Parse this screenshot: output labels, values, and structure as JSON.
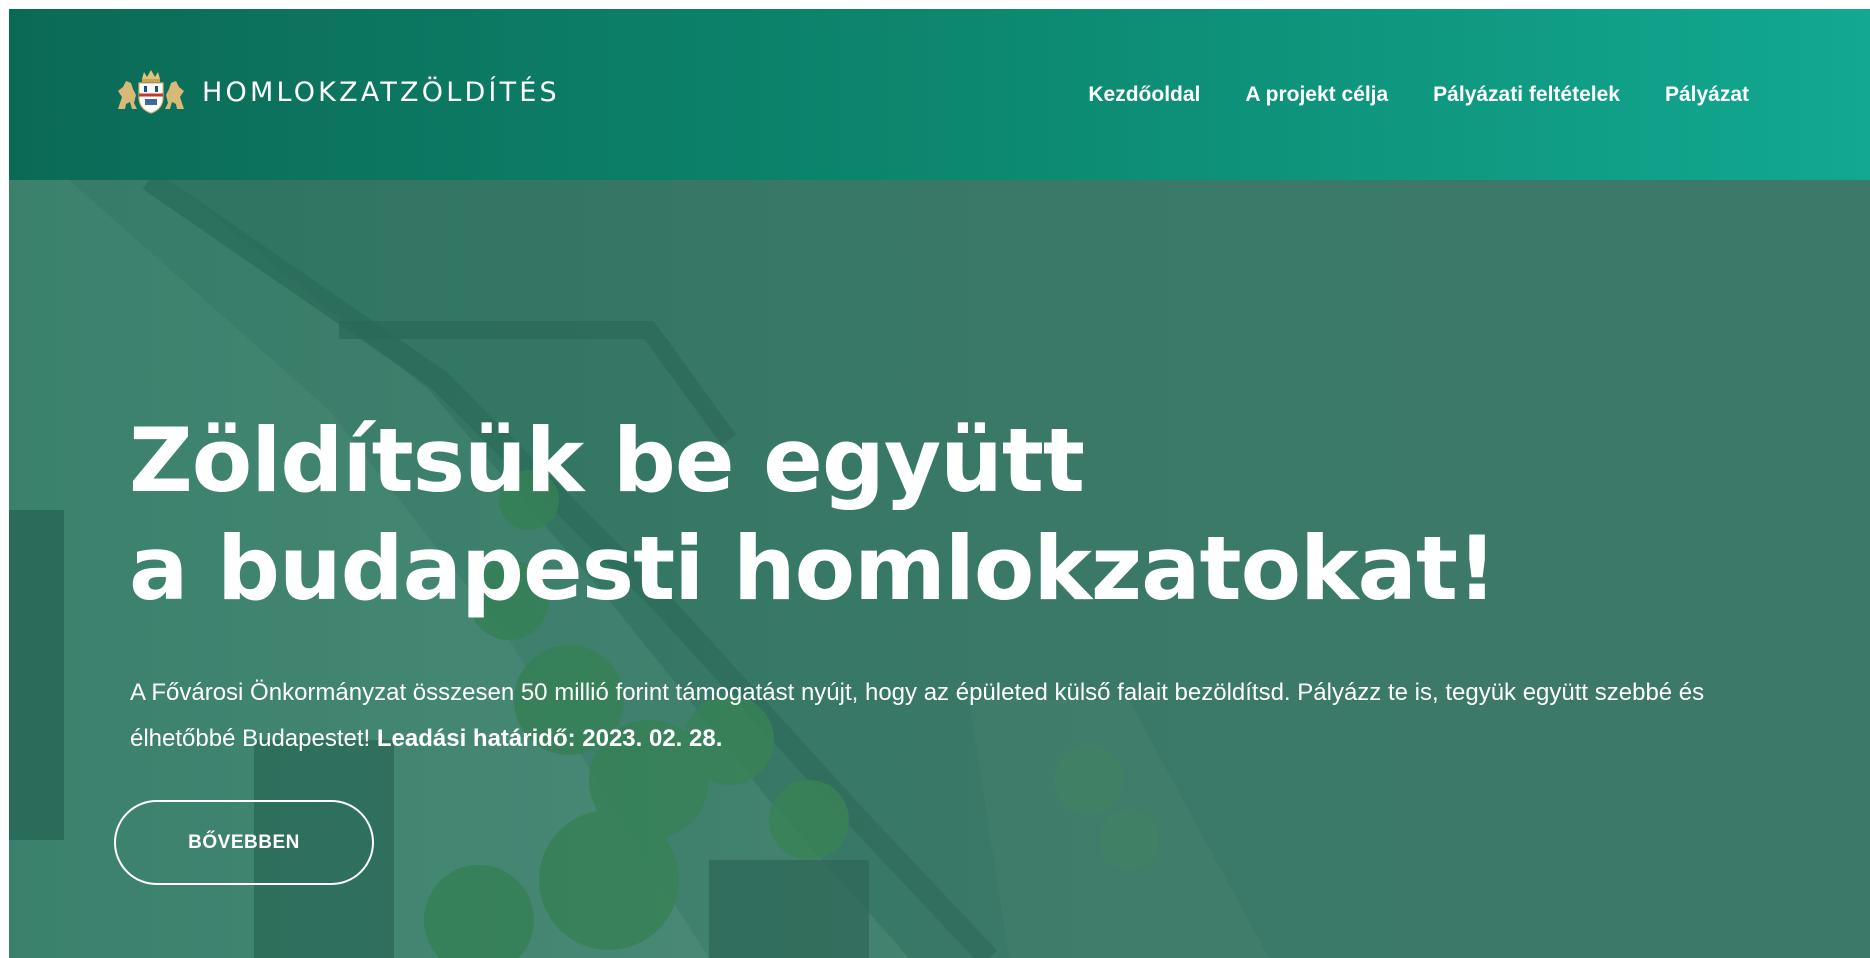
{
  "site": {
    "logo_text": "HOMLOKZATZÖLDÍTÉS"
  },
  "nav": {
    "items": [
      {
        "label": "Kezdőoldal"
      },
      {
        "label": "A projekt célja"
      },
      {
        "label": "Pályázati feltételek"
      },
      {
        "label": "Pályázat"
      }
    ]
  },
  "hero": {
    "title_line1": "Zöldítsük be együtt",
    "title_line2": "a budapesti homlokzatokat!",
    "description": "A Fővárosi Önkormányzat összesen 50 millió forint támogatást nyújt, hogy az épületed külső falait bezöldítsd. Pályázz te is, tegyük együtt szebbé és élhetőbbé Budapestet!",
    "deadline": "Leadási határidő: 2023. 02. 28.",
    "button_label": "BŐVEBBEN"
  },
  "colors": {
    "header_start": "#0b6a56",
    "header_end": "#12a891",
    "hero_overlay": "#3f7a6b",
    "text": "#ffffff"
  },
  "icons": {
    "logo": "budapest-coat-of-arms-icon"
  }
}
